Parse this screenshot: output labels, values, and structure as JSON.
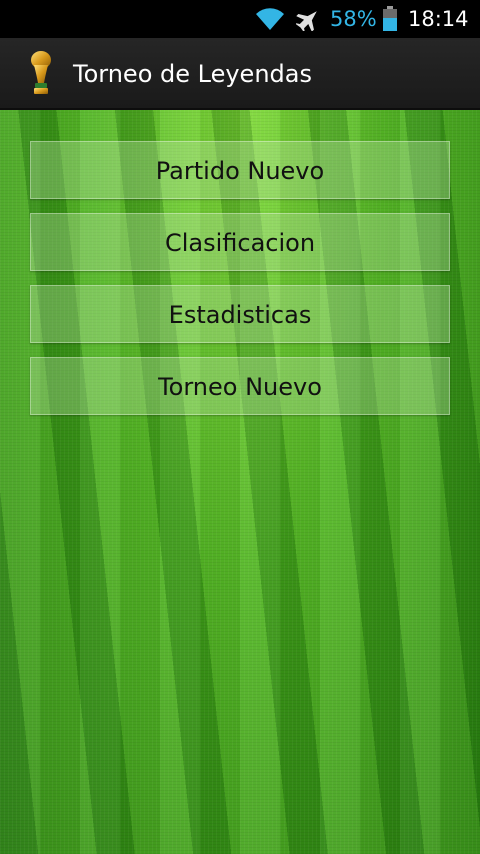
{
  "status_bar": {
    "battery_percent": "58%",
    "time": "18:14",
    "icons": [
      "wifi-icon",
      "airplane-mode-icon",
      "battery-icon"
    ],
    "battery_color": "#33b5e5"
  },
  "action_bar": {
    "title": "Torneo de Leyendas",
    "icon": "trophy-icon"
  },
  "menu": {
    "items": [
      {
        "label": "Partido Nuevo"
      },
      {
        "label": "Clasificacion"
      },
      {
        "label": "Estadisticas"
      },
      {
        "label": "Torneo Nuevo"
      }
    ]
  }
}
